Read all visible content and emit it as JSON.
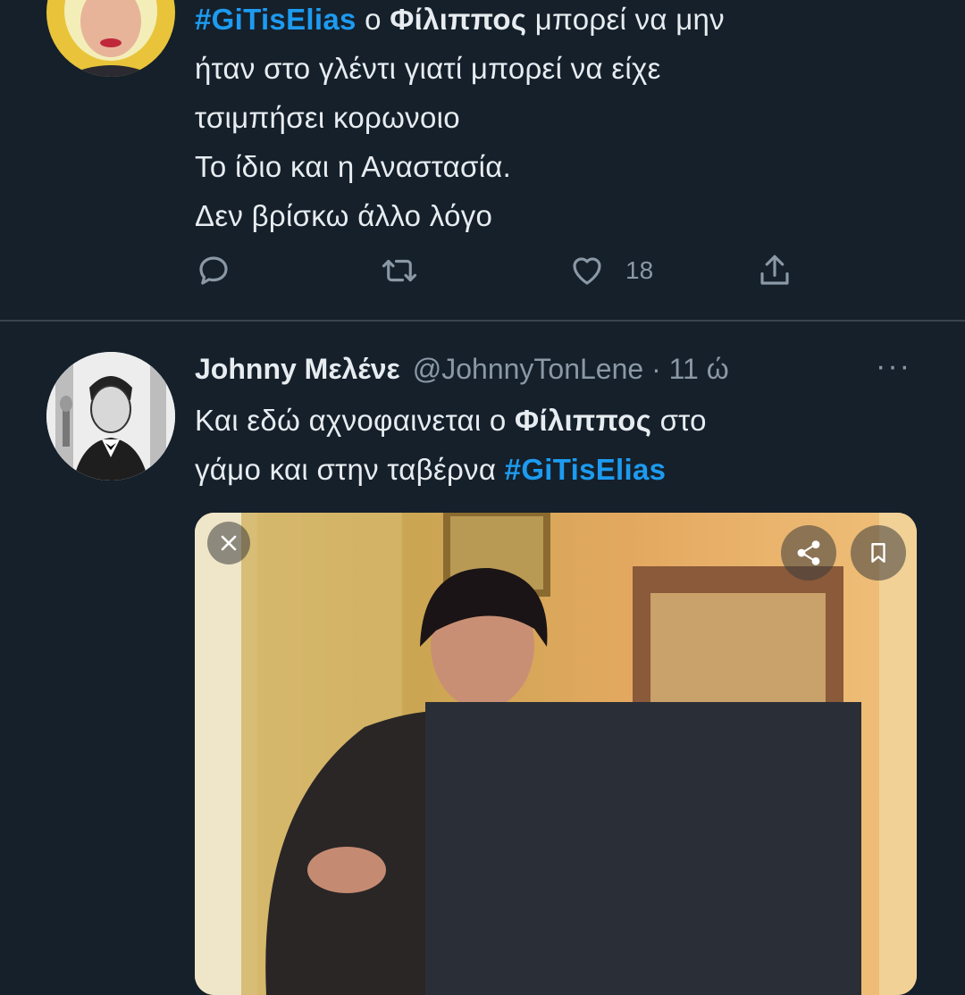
{
  "tweet1": {
    "text_parts": [
      {
        "t": "#GiTisElias",
        "cls": "hashtag"
      },
      {
        "t": " ο ",
        "cls": ""
      },
      {
        "t": "Φίλιππος",
        "cls": "bold"
      },
      {
        "t": " μπορεί να μην\nήταν στο γλέντι γιατί μπορεί να είχε\nτσιμπήσει κορωνοιο\nΤο ίδιο και η Αναστασία.\nΔεν βρίσκω άλλο λόγο",
        "cls": ""
      }
    ],
    "like_count": "18",
    "icons": {
      "reply": "reply-icon",
      "retweet": "retweet-icon",
      "like": "heart-icon",
      "share": "share-icon"
    }
  },
  "tweet2": {
    "author_name": "Johnny Μελένε",
    "author_handle": "@JohnnyTonLene · 11 ώ",
    "more_label": "···",
    "text_parts": [
      {
        "t": "Και εδώ αχνοφαινεται ο ",
        "cls": ""
      },
      {
        "t": "Φίλιππος",
        "cls": "bold"
      },
      {
        "t": " στο\nγάμο και στην ταβέρνα ",
        "cls": ""
      },
      {
        "t": "#GiTisElias",
        "cls": "hashtag"
      }
    ],
    "media_icons": {
      "close": "close-icon",
      "share": "share-icon",
      "bookmark": "bookmark-icon"
    }
  },
  "colors": {
    "background": "#15202b",
    "text": "#e7ecf0",
    "muted": "#8b98a5",
    "accent": "#1d9bf0",
    "divider": "#38444d"
  }
}
